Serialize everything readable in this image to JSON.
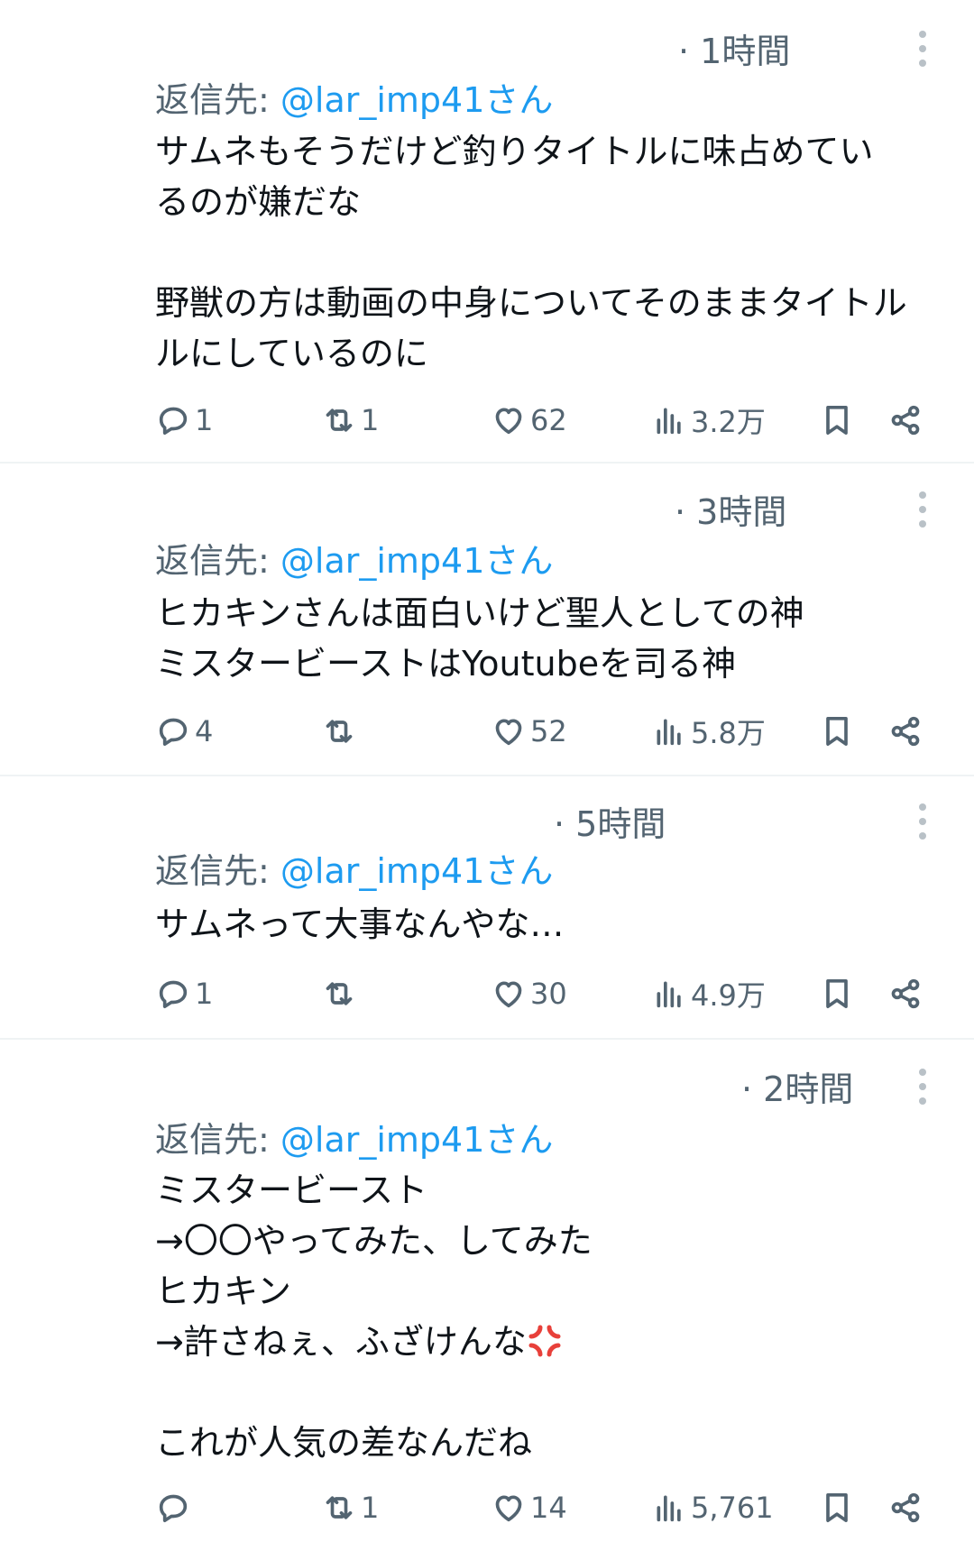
{
  "tweets": [
    {
      "time": "· 1時間",
      "reply_prefix": "返信先: ",
      "reply_handle": "@lar_imp41さん",
      "lines": [
        "サムネもそうだけど釣りタイトルに味占めてい",
        "るのが嫌だな",
        "",
        "野獣の方は動画の中身についてそのままタイトル",
        "ルにしているのに"
      ],
      "replies": "1",
      "retweets": "1",
      "likes": "62",
      "views": "3.2万"
    },
    {
      "time": "· 3時間",
      "reply_prefix": "返信先: ",
      "reply_handle": "@lar_imp41さん",
      "lines": [
        "ヒカキンさんは面白いけど聖人としての神",
        "ミスタービーストはYoutubeを司る神"
      ],
      "replies": "4",
      "retweets": "",
      "likes": "52",
      "views": "5.8万"
    },
    {
      "time": "· 5時間",
      "reply_prefix": "返信先: ",
      "reply_handle": "@lar_imp41さん",
      "lines": [
        "サムネって大事なんやな…"
      ],
      "replies": "1",
      "retweets": "",
      "likes": "30",
      "views": "4.9万"
    },
    {
      "time": "· 2時間",
      "reply_prefix": "返信先: ",
      "reply_handle": "@lar_imp41さん",
      "lines": [
        "ミスタービースト",
        "→〇〇やってみた、してみた",
        "ヒカキン",
        "→許さねぇ、ふざけんな",
        "",
        "これが人気の差なんだね"
      ],
      "replies": "",
      "retweets": "1",
      "likes": "14",
      "views": "5,761"
    }
  ],
  "icons": {
    "reply": "reply-icon",
    "retweet": "retweet-icon",
    "like": "heart-icon",
    "views": "views-icon",
    "bookmark": "bookmark-icon",
    "share": "share-icon",
    "more": "more-icon",
    "emoji": "anger-emoji"
  },
  "colors": {
    "text": "#0f1419",
    "secondary": "#536471",
    "link": "#1d9bf0",
    "divider": "#eff3f4"
  }
}
